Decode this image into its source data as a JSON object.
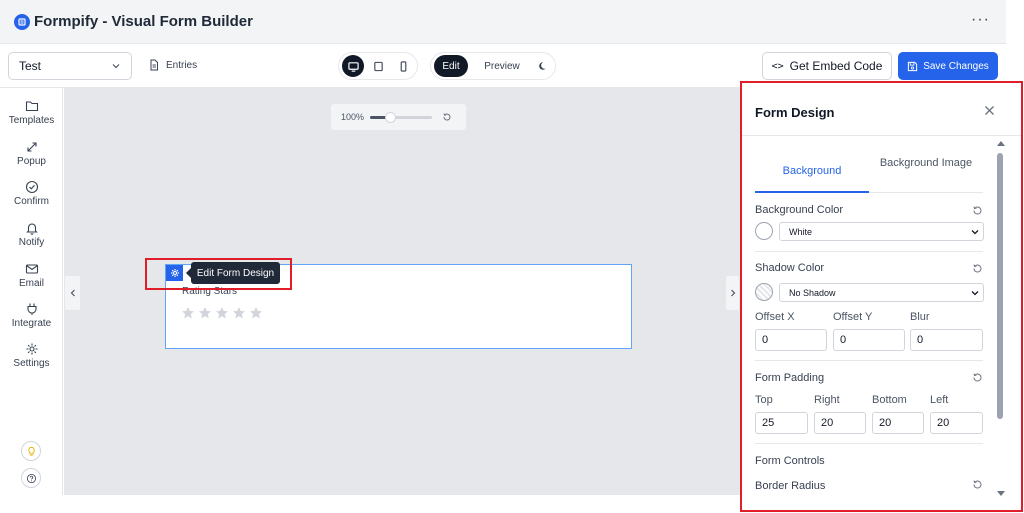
{
  "app": {
    "title": "Formpify - Visual Form Builder",
    "more_label": "···"
  },
  "toolbar": {
    "form_select": "Test",
    "entries_label": "Entries",
    "mode_edit": "Edit",
    "mode_preview": "Preview",
    "embed_code_icon": "<>",
    "embed_label": "Get Embed Code",
    "save_label": "Save Changes"
  },
  "sidebar": {
    "items": [
      {
        "label": "Templates",
        "icon": "folder-icon"
      },
      {
        "label": "Popup",
        "icon": "expand-arrows-icon"
      },
      {
        "label": "Confirm",
        "icon": "check-circle-icon"
      },
      {
        "label": "Notify",
        "icon": "bell-icon"
      },
      {
        "label": "Email",
        "icon": "mail-icon"
      },
      {
        "label": "Integrate",
        "icon": "plug-icon"
      },
      {
        "label": "Settings",
        "icon": "gear-icon"
      }
    ]
  },
  "canvas": {
    "zoom_label": "100%",
    "zoom_level": 0.33,
    "field_label": "Rating Stars",
    "stars_count": 5,
    "tooltip": "Edit Form Design"
  },
  "panel": {
    "title": "Form Design",
    "tabs": {
      "background": "Background",
      "background_image": "Background Image"
    },
    "background_color": {
      "label": "Background Color",
      "value": "White",
      "swatch": "#ffffff"
    },
    "shadow_color": {
      "label": "Shadow Color",
      "value": "No Shadow"
    },
    "offset_x": {
      "label": "Offset X",
      "value": "0"
    },
    "offset_y": {
      "label": "Offset Y",
      "value": "0"
    },
    "blur": {
      "label": "Blur",
      "value": "0"
    },
    "padding": {
      "label": "Form Padding",
      "top_label": "Top",
      "top": "25",
      "right_label": "Right",
      "right": "20",
      "bottom_label": "Bottom",
      "bottom": "20",
      "left_label": "Left",
      "left": "20"
    },
    "form_controls": "Form Controls",
    "border_radius": "Border Radius"
  },
  "colors": {
    "accent": "#2563eb",
    "highlight": "#e11d2a",
    "canvas": "#e5e7eb"
  }
}
